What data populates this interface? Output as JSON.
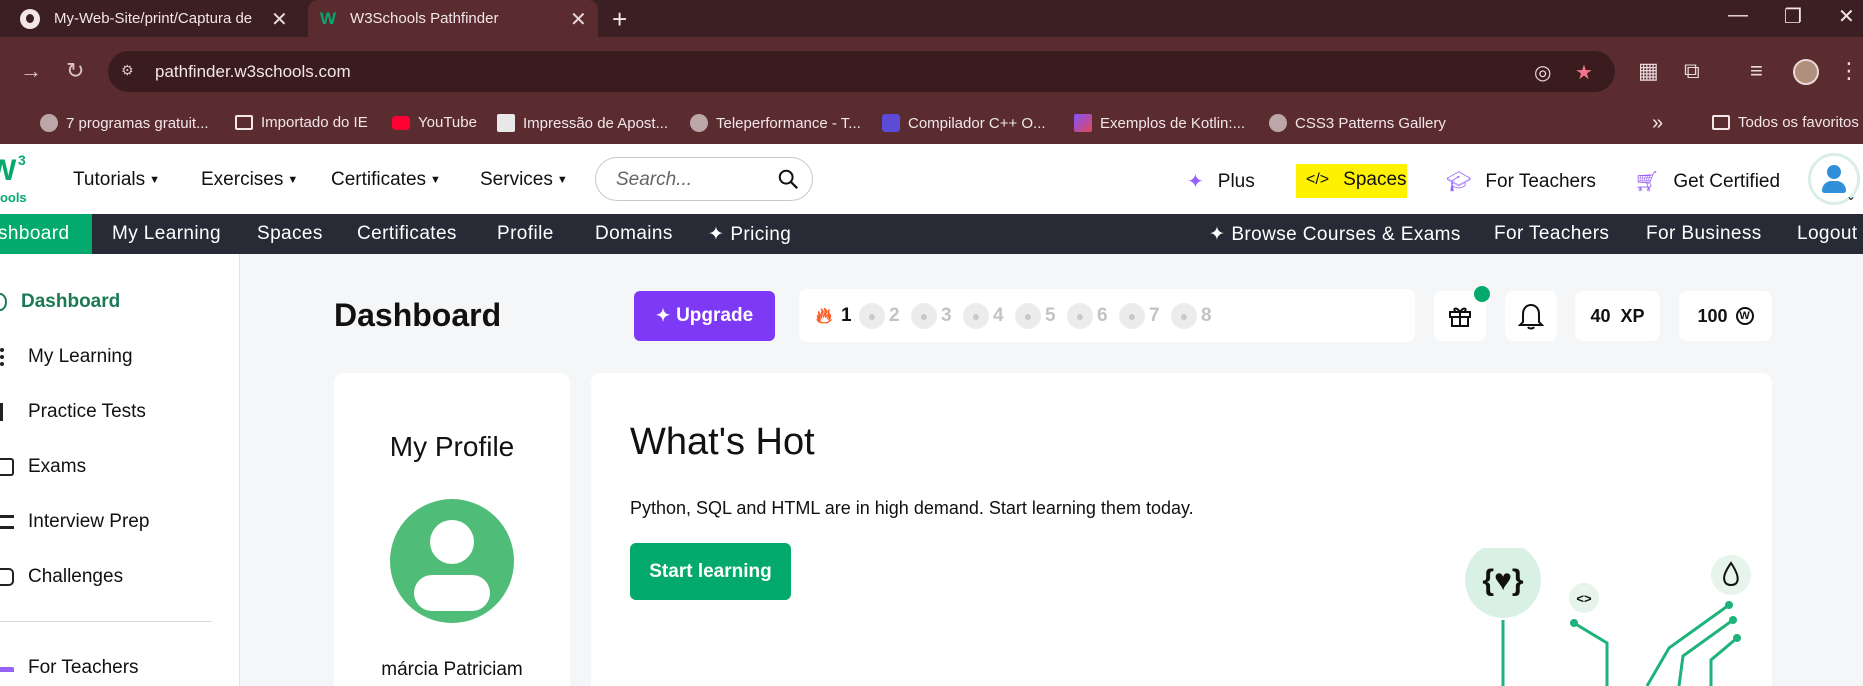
{
  "browser": {
    "tabs": [
      {
        "title": "My-Web-Site/print/Captura de"
      },
      {
        "title": "W3Schools Pathfinder"
      }
    ],
    "url": "pathfinder.w3schools.com",
    "bookmarks": [
      "7 programas gratuit...",
      "Importado do IE",
      "YouTube",
      "Impressão de Apost...",
      "Teleperformance - T...",
      "Compilador C++ O...",
      "Exemplos de Kotlin:...",
      "CSS3 Patterns Gallery"
    ],
    "all_bookmarks": "Todos os favoritos",
    "more_bookmarks": "»"
  },
  "logo": {
    "main": "W",
    "sup": "3",
    "sub": "hools"
  },
  "header": {
    "nav": [
      "Tutorials",
      "Exercises",
      "Certificates",
      "Services"
    ],
    "search_placeholder": "Search...",
    "right": [
      "Plus",
      "Spaces",
      "For Teachers",
      "Get Certified"
    ],
    "spaces_icon": "</>"
  },
  "subnav": {
    "left": [
      "shboard",
      "My Learning",
      "Spaces",
      "Certificates",
      "Profile",
      "Domains",
      "Pricing"
    ],
    "right": [
      "Browse Courses & Exams",
      "For Teachers",
      "For Business",
      "Logout"
    ]
  },
  "sidebar": {
    "items": [
      "Dashboard",
      "My Learning",
      "Practice Tests",
      "Exams",
      "Interview Prep",
      "Challenges"
    ],
    "footer_item": "For Teachers"
  },
  "dashboard": {
    "title": "Dashboard",
    "upgrade_label": "Upgrade",
    "streak_days": [
      "1",
      "2",
      "3",
      "4",
      "5",
      "6",
      "7",
      "8"
    ],
    "streak_current": 1,
    "xp": "40",
    "xp_unit": "XP",
    "coins": "100"
  },
  "profile": {
    "title": "My Profile",
    "name": "márcia Patriciam"
  },
  "hot": {
    "title": "What's Hot",
    "text": "Python, SQL and HTML are in high demand. Start learning them today.",
    "cta": "Start learning",
    "badge_text": "{♥}",
    "code_badge": "<>"
  },
  "colors": {
    "brand_green": "#04aa6d",
    "purple": "#7d39f5",
    "dark_nav": "#282a35",
    "highlight": "#fff200",
    "browser_chrome": "#5a2c30"
  }
}
